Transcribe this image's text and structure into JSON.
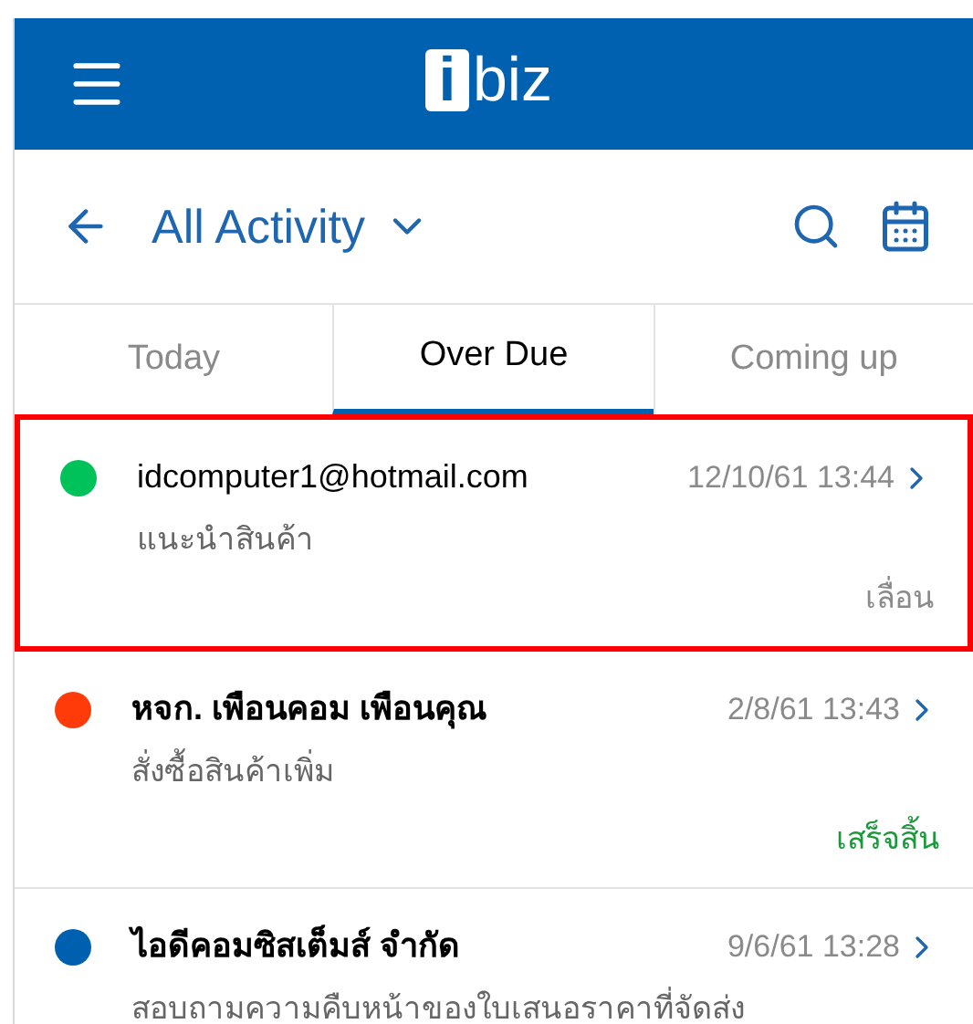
{
  "header": {
    "logo_mark": "i",
    "logo_text": "biz"
  },
  "toolbar": {
    "title": "All Activity"
  },
  "tabs": [
    {
      "label": "Today",
      "selected": false
    },
    {
      "label": "Over Due",
      "selected": true
    },
    {
      "label": "Coming up",
      "selected": false
    }
  ],
  "activities": [
    {
      "name": "idcomputer1@hotmail.com",
      "bold": false,
      "color": "#00c25a",
      "datetime": "12/10/61 13:44",
      "subject": "แนะนำสินค้า",
      "status": "เลื่อน",
      "kind": "postponed",
      "highlighted": true
    },
    {
      "name": "หจก. เพือนคอม เพือนคุณ",
      "bold": true,
      "color": "#ff3b0a",
      "datetime": "2/8/61 13:43",
      "subject": "สั่งซื้อสินค้าเพิ่ม",
      "status": "เสร็จสิ้น",
      "kind": "done",
      "highlighted": false
    },
    {
      "name": "ไอดีคอมซิสเต็มส์ จำกัด",
      "bold": true,
      "color": "#0060b0",
      "datetime": "9/6/61 13:28",
      "subject": "สอบถามความคืบหน้าของใบเสนอราคาที่จัดส่ง",
      "highlighted": false
    }
  ]
}
